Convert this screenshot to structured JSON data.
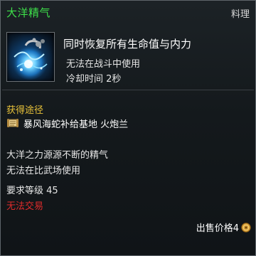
{
  "tooltip": {
    "title": "大洋精气",
    "category": "料理",
    "icon": "blue-energy-orb-icon",
    "effect": "同时恢复所有生命值与内力",
    "restriction": "无法在战斗中使用",
    "cooldown": "冷却时间 2秒",
    "source_header": "获得途径",
    "source_icon": "scroll-icon",
    "source": "暴风海蛇补给基地 火炮兰",
    "flavor_line1": "大洋之力源源不断的精气",
    "flavor_line2": "无法在比武场使用",
    "required_level": "要求等级 45",
    "trade_status": "无法交易",
    "sell_price": "出售价格4",
    "currency_icon": "copper-coin-icon"
  },
  "colors": {
    "title": "#3ee04a",
    "section_header": "#e8c23a",
    "warning": "#e02b2b",
    "background": "#171c1f",
    "border": "#5e656a"
  }
}
